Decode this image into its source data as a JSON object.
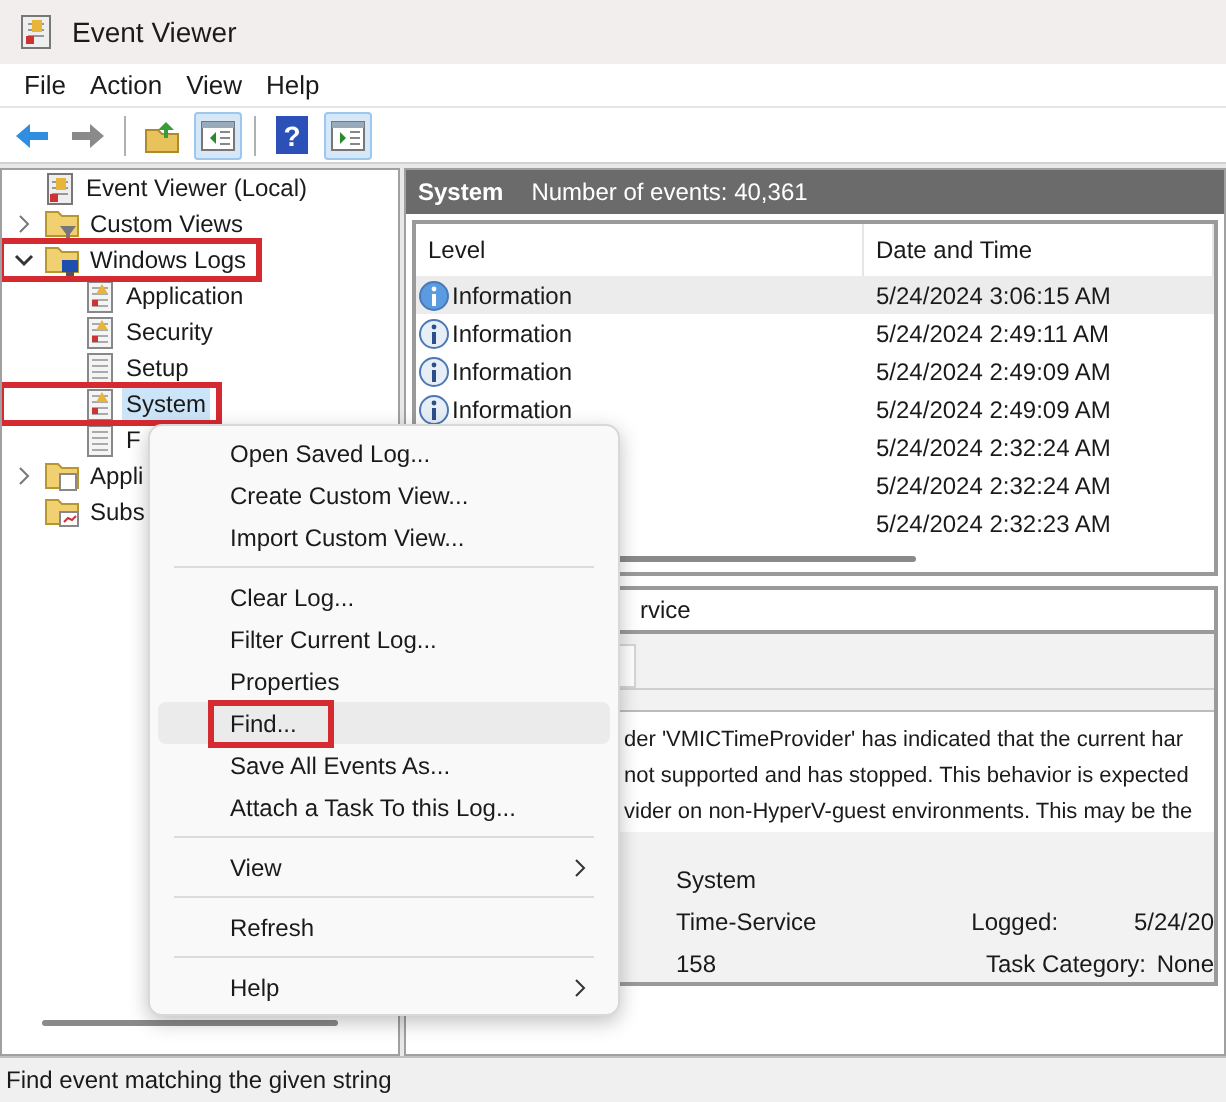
{
  "window": {
    "title": "Event Viewer"
  },
  "menu_bar": [
    "File",
    "Action",
    "View",
    "Help"
  ],
  "toolbar": [
    {
      "kind": "back",
      "pressed": false
    },
    {
      "kind": "forward",
      "pressed": false
    },
    {
      "kind": "separator"
    },
    {
      "kind": "up",
      "pressed": false
    },
    {
      "kind": "tree",
      "pressed": true
    },
    {
      "kind": "separator"
    },
    {
      "kind": "help",
      "glyph": "?",
      "pressed": false
    },
    {
      "kind": "pane",
      "pressed": true
    }
  ],
  "tree": {
    "label": "Event Viewer (Local)",
    "children": [
      {
        "label": "Custom Views",
        "kind": "filter-folder",
        "expanded": false,
        "annotated": false
      },
      {
        "label": "Windows Logs",
        "kind": "log-folder",
        "expanded": true,
        "annotated": true,
        "children": [
          {
            "label": "Application",
            "kind": "log",
            "selected": false,
            "annotated": false
          },
          {
            "label": "Security",
            "kind": "log",
            "selected": false,
            "annotated": false
          },
          {
            "label": "Setup",
            "kind": "plain-log",
            "selected": false,
            "annotated": false
          },
          {
            "label": "System",
            "kind": "log",
            "selected": true,
            "annotated": true
          },
          {
            "label": "F",
            "kind": "plain-log",
            "selected": false,
            "annotated": false
          }
        ]
      },
      {
        "label": "Appli",
        "kind": "folder",
        "expanded": false,
        "annotated": false
      },
      {
        "label": "Subs",
        "kind": "sub-folder",
        "annotated": false
      }
    ]
  },
  "log_header": {
    "name": "System",
    "count": "Number of events: 40,361"
  },
  "events": {
    "columns": [
      "Level",
      "Date and Time"
    ],
    "rows": [
      {
        "level": "Information",
        "date": "5/24/2024 3:06:15 AM",
        "selected": true
      },
      {
        "level": "Information",
        "date": "5/24/2024 2:49:11 AM",
        "selected": false
      },
      {
        "level": "Information",
        "date": "5/24/2024 2:49:09 AM",
        "selected": false
      },
      {
        "level": "Information",
        "date": "5/24/2024 2:49:09 AM",
        "selected": false
      },
      {
        "date": "5/24/2024 2:32:24 AM",
        "selected": false
      },
      {
        "date": "5/24/2024 2:32:24 AM",
        "selected": false
      },
      {
        "date": "5/24/2024 2:32:23 AM",
        "selected": false
      }
    ]
  },
  "details": {
    "title": "rvice",
    "description": [
      "der 'VMICTimeProvider' has indicated that the current har",
      "not supported and has stopped. This behavior is expected",
      "vider on non-HyperV-guest environments. This may be the"
    ],
    "fields": [
      {
        "value": "System"
      },
      {
        "value": "Time-Service",
        "label": "Logged:",
        "value_2": "5/24/20"
      },
      {
        "value": "158",
        "label": "Task Category:",
        "value_2": "None"
      }
    ]
  },
  "context_menu": [
    {
      "kind": "item",
      "label": "Open Saved Log...",
      "highlighted": false,
      "annotated": false
    },
    {
      "kind": "item",
      "label": "Create Custom View...",
      "highlighted": false,
      "annotated": false
    },
    {
      "kind": "item",
      "label": "Import Custom View...",
      "highlighted": false,
      "annotated": false
    },
    {
      "kind": "separator"
    },
    {
      "kind": "item",
      "label": "Clear Log...",
      "highlighted": false,
      "annotated": false
    },
    {
      "kind": "item",
      "label": "Filter Current Log...",
      "highlighted": false,
      "annotated": false
    },
    {
      "kind": "item",
      "label": "Properties",
      "highlighted": false,
      "annotated": false
    },
    {
      "kind": "item",
      "label": "Find...",
      "highlighted": true,
      "annotated": true
    },
    {
      "kind": "item",
      "label": "Save All Events As...",
      "highlighted": false,
      "annotated": false
    },
    {
      "kind": "item",
      "label": "Attach a Task To this Log...",
      "highlighted": false,
      "annotated": false
    },
    {
      "kind": "separator"
    },
    {
      "kind": "submenu",
      "label": "View",
      "highlighted": false,
      "annotated": false
    },
    {
      "kind": "separator"
    },
    {
      "kind": "item",
      "label": "Refresh",
      "highlighted": false,
      "annotated": false
    },
    {
      "kind": "separator"
    },
    {
      "kind": "submenu",
      "label": "Help",
      "highlighted": false,
      "annotated": false
    }
  ],
  "status_bar": "Find event matching the given string"
}
